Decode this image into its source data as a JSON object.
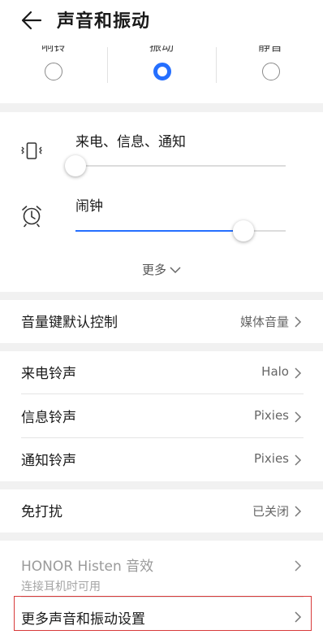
{
  "header": {
    "title": "声音和振动",
    "back_icon": "arrow-left-icon"
  },
  "modes": {
    "options": [
      {
        "label": "响铃",
        "checked": false
      },
      {
        "label": "振动",
        "checked": true
      },
      {
        "label": "静音",
        "checked": false
      }
    ],
    "accent_color": "#256fff"
  },
  "volumes": {
    "items": [
      {
        "label": "来电、信息、通知",
        "icon": "vibrate-phone-icon",
        "level_percent": 0
      },
      {
        "label": "闹钟",
        "icon": "alarm-clock-icon",
        "level_percent": 80
      }
    ],
    "more_label": "更多"
  },
  "volume_key": {
    "title": "音量键默认控制",
    "value": "媒体音量"
  },
  "ringtones": [
    {
      "title": "来电铃声",
      "value": "Halo"
    },
    {
      "title": "信息铃声",
      "value": "Pixies"
    },
    {
      "title": "通知铃声",
      "value": "Pixies"
    }
  ],
  "dnd": {
    "title": "免打扰",
    "value": "已关闭"
  },
  "histen": {
    "title": "HONOR Histen 音效",
    "subtitle": "连接耳机时可用"
  },
  "more_settings": {
    "title": "更多声音和振动设置",
    "highlight_color": "#d83a3a"
  }
}
